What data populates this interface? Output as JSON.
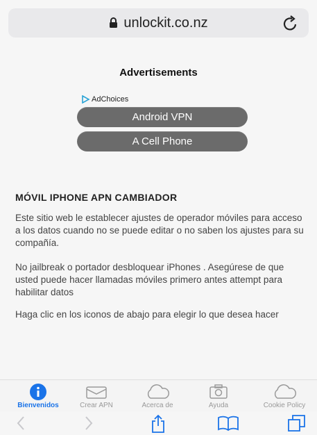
{
  "browser": {
    "url": "unlockit.co.nz",
    "lock_icon": "lock-icon",
    "reload_icon": "reload-icon"
  },
  "ads": {
    "title": "Advertisements",
    "adchoices_label": "AdChoices",
    "buttons": [
      "Android VPN",
      "A Cell Phone"
    ]
  },
  "main": {
    "heading": "MÓVIL IPHONE APN CAMBIADOR",
    "paragraphs": [
      "Este sitio web le establecer ajustes de operador móviles para acceso a los datos cuando no se puede editar o no saben los ajustes para su compañía.",
      "No jailbreak o portador desbloquear iPhones . Asegúrese de que usted puede hacer llamadas móviles primero antes attempt para habilitar datos",
      "Haga clic en los iconos de abajo para elegir lo que desea hacer"
    ]
  },
  "tabs": [
    {
      "label": "Bienvenidos",
      "icon": "info-icon",
      "active": true
    },
    {
      "label": "Crear APN",
      "icon": "envelope-icon",
      "active": false
    },
    {
      "label": "Acerca de",
      "icon": "cloud-icon",
      "active": false
    },
    {
      "label": "Ayuda",
      "icon": "camera-icon",
      "active": false
    },
    {
      "label": "Cookie Policy",
      "icon": "cloud-icon",
      "active": false
    }
  ],
  "colors": {
    "accent": "#1a73e8",
    "ad_button": "#6b6b6b",
    "page_bg": "#f6f6f6"
  }
}
